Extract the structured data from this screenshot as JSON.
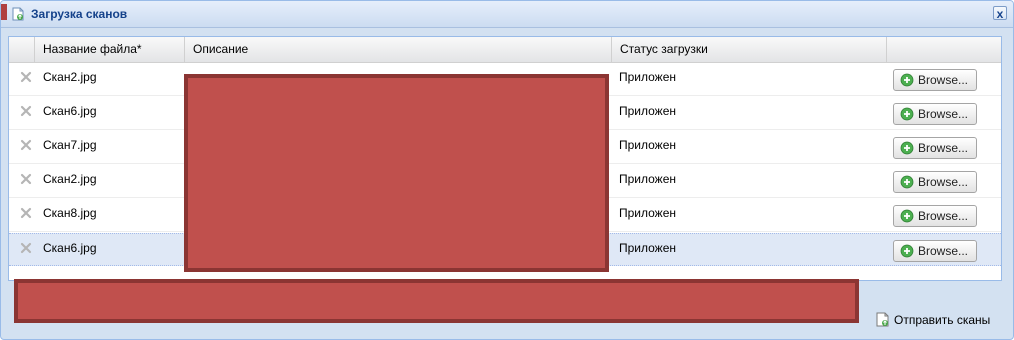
{
  "window": {
    "title": "Загрузка сканов",
    "close_label": "x"
  },
  "grid": {
    "columns": [
      "Название файла*",
      "Описание",
      "Статус загрузки"
    ],
    "rows": [
      {
        "file": "Скан2.jpg",
        "status": "Приложен",
        "browse": "Browse...",
        "selected": false
      },
      {
        "file": "Скан6.jpg",
        "status": "Приложен",
        "browse": "Browse...",
        "selected": false
      },
      {
        "file": "Скан7.jpg",
        "status": "Приложен",
        "browse": "Browse...",
        "selected": false
      },
      {
        "file": "Скан2.jpg",
        "status": "Приложен",
        "browse": "Browse...",
        "selected": false
      },
      {
        "file": "Скан8.jpg",
        "status": "Приложен",
        "browse": "Browse...",
        "selected": false
      },
      {
        "file": "Скан6.jpg",
        "status": "Приложен",
        "browse": "Browse...",
        "selected": true
      }
    ]
  },
  "footer": {
    "send_label": "Отправить сканы"
  },
  "icons": {
    "delete": "delete-x-icon",
    "browse": "add-circle-icon",
    "send": "document-upload-icon",
    "window": "document-upload-icon"
  },
  "colors": {
    "accent": "#15428b",
    "redaction": "#c0504d",
    "selected_row": "#dfe8f6",
    "add_green": "#4caf50"
  }
}
